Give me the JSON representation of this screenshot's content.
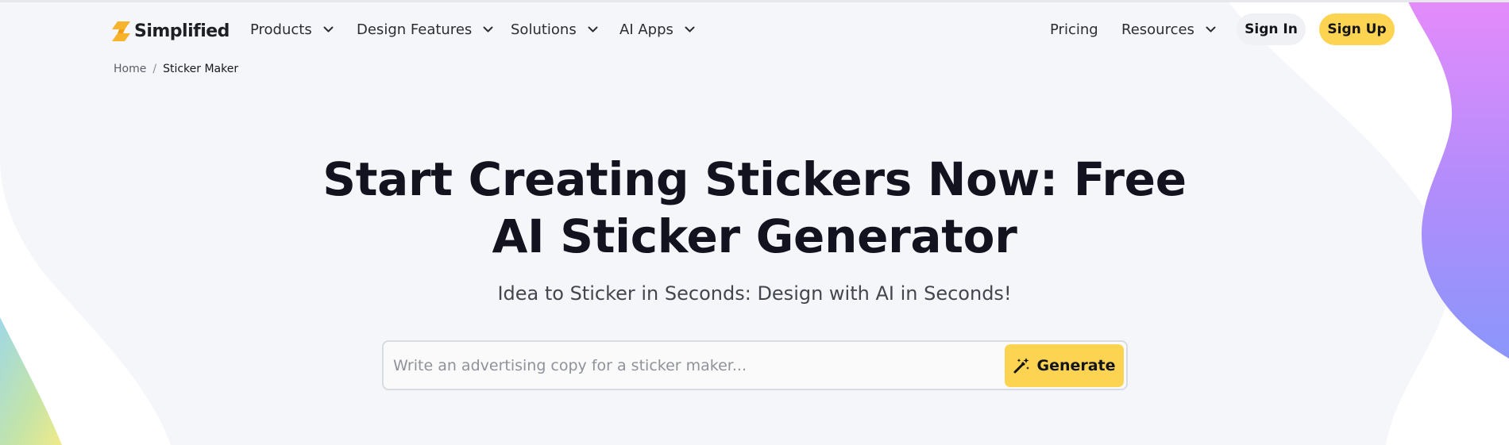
{
  "brand": {
    "name": "Simplified",
    "logo_icon": "simplified-logo-icon"
  },
  "nav": {
    "items": [
      {
        "label": "Products",
        "icon": "chevron-down-icon"
      },
      {
        "label": "Design Features",
        "icon": "chevron-down-icon"
      },
      {
        "label": "Solutions",
        "icon": "chevron-down-icon"
      },
      {
        "label": "AI Apps",
        "icon": "chevron-down-icon"
      }
    ],
    "pricing": "Pricing",
    "resources": "Resources",
    "sign_in": "Sign In",
    "sign_up": "Sign Up"
  },
  "breadcrumb": {
    "home": "Home",
    "separator": "/",
    "current": "Sticker Maker"
  },
  "hero": {
    "title_line1": "Start Creating Stickers Now: Free",
    "title_line2": "AI Sticker Generator",
    "subtitle": "Idea to Sticker in Seconds: Design with AI in Seconds!",
    "input_placeholder": "Write an advertising copy for a sticker maker...",
    "input_value": "",
    "generate_label": "Generate",
    "generate_icon": "magic-wand-icon"
  },
  "colors": {
    "accent": "#fdd452",
    "text_dark": "#12131f",
    "background": "#f5f6fa",
    "blob_pink": "#e58bfb",
    "blob_violet": "#9e8dfb"
  }
}
